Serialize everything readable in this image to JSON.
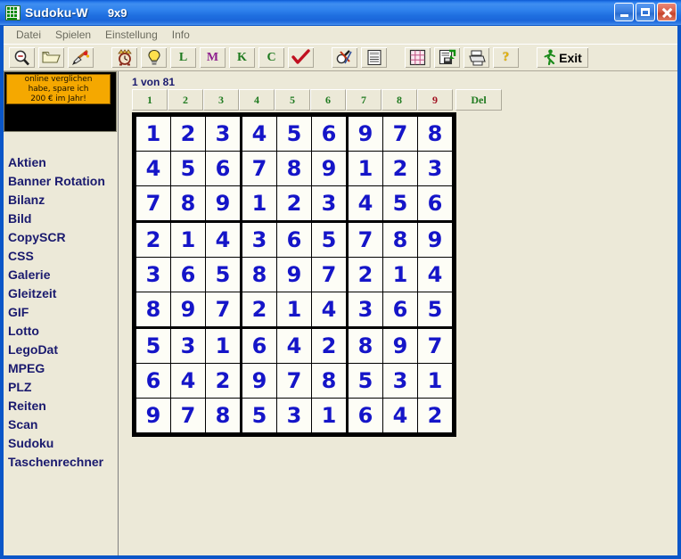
{
  "window": {
    "title": "Sudoku-W",
    "subtitle": "9x9",
    "app_icon": "sudoku-grid-icon",
    "minimize_label": "Minimize",
    "maximize_label": "Maximize",
    "close_label": "Close",
    "title_bar_color": "#2f7ae4",
    "face_color": "#ece9d8"
  },
  "menubar": {
    "items": [
      {
        "label": "Datei"
      },
      {
        "label": "Spielen"
      },
      {
        "label": "Einstellung"
      },
      {
        "label": "Info"
      }
    ]
  },
  "toolbar": {
    "buttons": [
      {
        "name": "zoom-out-button",
        "icon": "magnifier-minus-icon",
        "label": ""
      },
      {
        "name": "open-button",
        "icon": "folder-open-icon",
        "label": ""
      },
      {
        "name": "paint-button",
        "icon": "paint-brush-icon",
        "label": ""
      },
      {
        "name": "timer-button",
        "icon": "alarm-clock-icon",
        "label": ""
      },
      {
        "name": "hint-button",
        "icon": "lightbulb-icon",
        "label": ""
      },
      {
        "name": "level-l-button",
        "icon": "letter-icon",
        "label": "L",
        "color": "#1f7a1f"
      },
      {
        "name": "level-m-button",
        "icon": "letter-icon",
        "label": "M",
        "color": "#8e1f8e"
      },
      {
        "name": "level-k-button",
        "icon": "letter-icon",
        "label": "K",
        "color": "#1f7a1f"
      },
      {
        "name": "level-c-button",
        "icon": "letter-icon",
        "label": "C",
        "color": "#1f7a1f"
      },
      {
        "name": "check-button",
        "icon": "red-check-icon",
        "label": ""
      },
      {
        "name": "solve-button",
        "icon": "magnifier-tools-icon",
        "label": ""
      },
      {
        "name": "list-button",
        "icon": "document-list-icon",
        "label": ""
      },
      {
        "name": "candidates-button",
        "icon": "pink-grid-icon",
        "label": ""
      },
      {
        "name": "save-button",
        "icon": "save-disk-icon",
        "label": ""
      },
      {
        "name": "print-button",
        "icon": "printer-icon",
        "label": ""
      },
      {
        "name": "help-button",
        "icon": "question-mark-icon",
        "label": ""
      },
      {
        "name": "exit-button",
        "icon": "running-man-icon",
        "label": "Exit"
      }
    ]
  },
  "sidebar": {
    "banner": {
      "lines": [
        "online verglichen",
        "habe, spare ich",
        "200 € im Jahr!"
      ],
      "background": "#000000",
      "highlight": "#f5a800"
    },
    "items": [
      {
        "label": "Aktien"
      },
      {
        "label": "Banner Rotation"
      },
      {
        "label": "Bilanz"
      },
      {
        "label": "Bild"
      },
      {
        "label": "CopySCR"
      },
      {
        "label": "CSS"
      },
      {
        "label": "Galerie"
      },
      {
        "label": "Gleitzeit"
      },
      {
        "label": "GIF"
      },
      {
        "label": "Lotto"
      },
      {
        "label": "LegoDat"
      },
      {
        "label": "MPEG"
      },
      {
        "label": "PLZ"
      },
      {
        "label": "Reiten"
      },
      {
        "label": "Scan"
      },
      {
        "label": "Sudoku"
      },
      {
        "label": "Taschenrechner"
      }
    ]
  },
  "main": {
    "counter": "1 von 81",
    "number_buttons": [
      {
        "label": "1",
        "color": "#1f7a1f"
      },
      {
        "label": "2",
        "color": "#1f7a1f"
      },
      {
        "label": "3",
        "color": "#1f7a1f"
      },
      {
        "label": "4",
        "color": "#1f7a1f"
      },
      {
        "label": "5",
        "color": "#1f7a1f"
      },
      {
        "label": "6",
        "color": "#1f7a1f"
      },
      {
        "label": "7",
        "color": "#1f7a1f"
      },
      {
        "label": "8",
        "color": "#1f7a1f"
      },
      {
        "label": "9",
        "color": "#a01020"
      }
    ],
    "delete_button": {
      "label": "Del",
      "color": "#1f7a1f"
    },
    "grid": {
      "size": 9,
      "digit_color": "#1515c8",
      "rows": [
        [
          "1",
          "2",
          "3",
          "4",
          "5",
          "6",
          "9",
          "7",
          "8"
        ],
        [
          "4",
          "5",
          "6",
          "7",
          "8",
          "9",
          "1",
          "2",
          "3"
        ],
        [
          "7",
          "8",
          "9",
          "1",
          "2",
          "3",
          "4",
          "5",
          "6"
        ],
        [
          "2",
          "1",
          "4",
          "3",
          "6",
          "5",
          "7",
          "8",
          "9"
        ],
        [
          "3",
          "6",
          "5",
          "8",
          "9",
          "7",
          "2",
          "1",
          "4"
        ],
        [
          "8",
          "9",
          "7",
          "2",
          "1",
          "4",
          "3",
          "6",
          "5"
        ],
        [
          "5",
          "3",
          "1",
          "6",
          "4",
          "2",
          "8",
          "9",
          "7"
        ],
        [
          "6",
          "4",
          "2",
          "9",
          "7",
          "8",
          "5",
          "3",
          "1"
        ],
        [
          "9",
          "7",
          "8",
          "5",
          "3",
          "1",
          "6",
          "4",
          "2"
        ]
      ]
    }
  }
}
